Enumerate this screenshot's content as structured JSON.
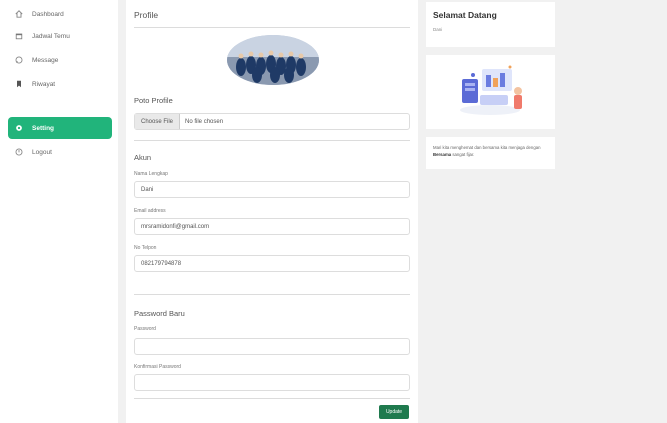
{
  "sidebar": {
    "items": [
      {
        "label": "Dashboard",
        "icon": "home-icon"
      },
      {
        "label": "Jadwal Temu",
        "icon": "calendar-icon"
      },
      {
        "label": "Message",
        "icon": "message-icon"
      },
      {
        "label": "Riwayat",
        "icon": "bookmark-icon"
      },
      {
        "label": "Setting",
        "icon": "gear-icon"
      },
      {
        "label": "Logout",
        "icon": "logout-icon"
      }
    ],
    "active": "Setting",
    "active_color": "#21b47b"
  },
  "profile": {
    "title": "Profile",
    "photo_label": "Poto Profile",
    "file_button": "Choose File",
    "file_status": "No file chosen"
  },
  "account": {
    "title": "Akun",
    "name_label": "Nama Lengkap",
    "name_value": "Dani",
    "email_label": "Email address",
    "email_value": "mrsramidonfi@gmail.com",
    "phone_label": "No Telpon",
    "phone_value": "082179794878"
  },
  "password": {
    "title": "Password Baru",
    "password_label": "Password",
    "password_value": "",
    "confirm_label": "Konfirmasi Password",
    "confirm_value": "",
    "update_button": "Update"
  },
  "welcome": {
    "title": "Selamat Datang",
    "user": "Dani",
    "message_text": "Mari kita menghemat dan bersama kita menjaga dengan ",
    "message_bold": "Bersama",
    "message_end": " sangat fijar."
  }
}
